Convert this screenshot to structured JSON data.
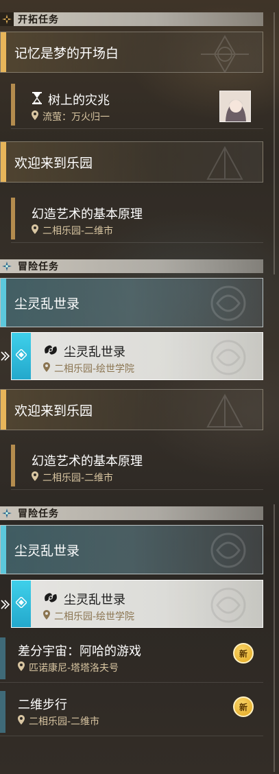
{
  "sections": [
    {
      "title": "开拓任务",
      "icon": "trailblaze-icon",
      "accent": "#e7b55a"
    },
    {
      "title": "冒险任务",
      "icon": "adventure-icon",
      "accent": "#5cc8dc"
    },
    {
      "title": "冒险任务",
      "icon": "adventure-icon",
      "accent": "#5cc8dc"
    }
  ],
  "banners": [
    {
      "title": "记忆是梦的开场白"
    },
    {
      "title": "欢迎来到乐园"
    },
    {
      "title": "尘灵乱世录"
    },
    {
      "title": "欢迎来到乐园"
    },
    {
      "title": "尘灵乱世录"
    }
  ],
  "quests": [
    {
      "title": "树上的灾兆",
      "location": "流萤：万火归一",
      "icon": "hourglass-icon"
    },
    {
      "title": "幻造艺术的基本原理",
      "location": "二相乐园-二维市"
    },
    {
      "title": "尘灵乱世录",
      "location": "二相乐园-绘世学院",
      "icon": "dust-spirit-icon"
    },
    {
      "title": "幻造艺术的基本原理",
      "location": "二相乐园-二维市"
    },
    {
      "title": "尘灵乱世录",
      "location": "二相乐园-绘世学院",
      "icon": "dust-spirit-icon"
    },
    {
      "title": "差分宇宙：阿哈的游戏",
      "location": "匹诺康尼-塔塔洛夫号",
      "badge": "新"
    },
    {
      "title": "二维步行",
      "location": "二相乐园-二维市",
      "badge": "新"
    }
  ],
  "colors": {
    "gold": "#e7b55a",
    "blue": "#5cc8dc",
    "location_text": "#d9c6a2"
  }
}
